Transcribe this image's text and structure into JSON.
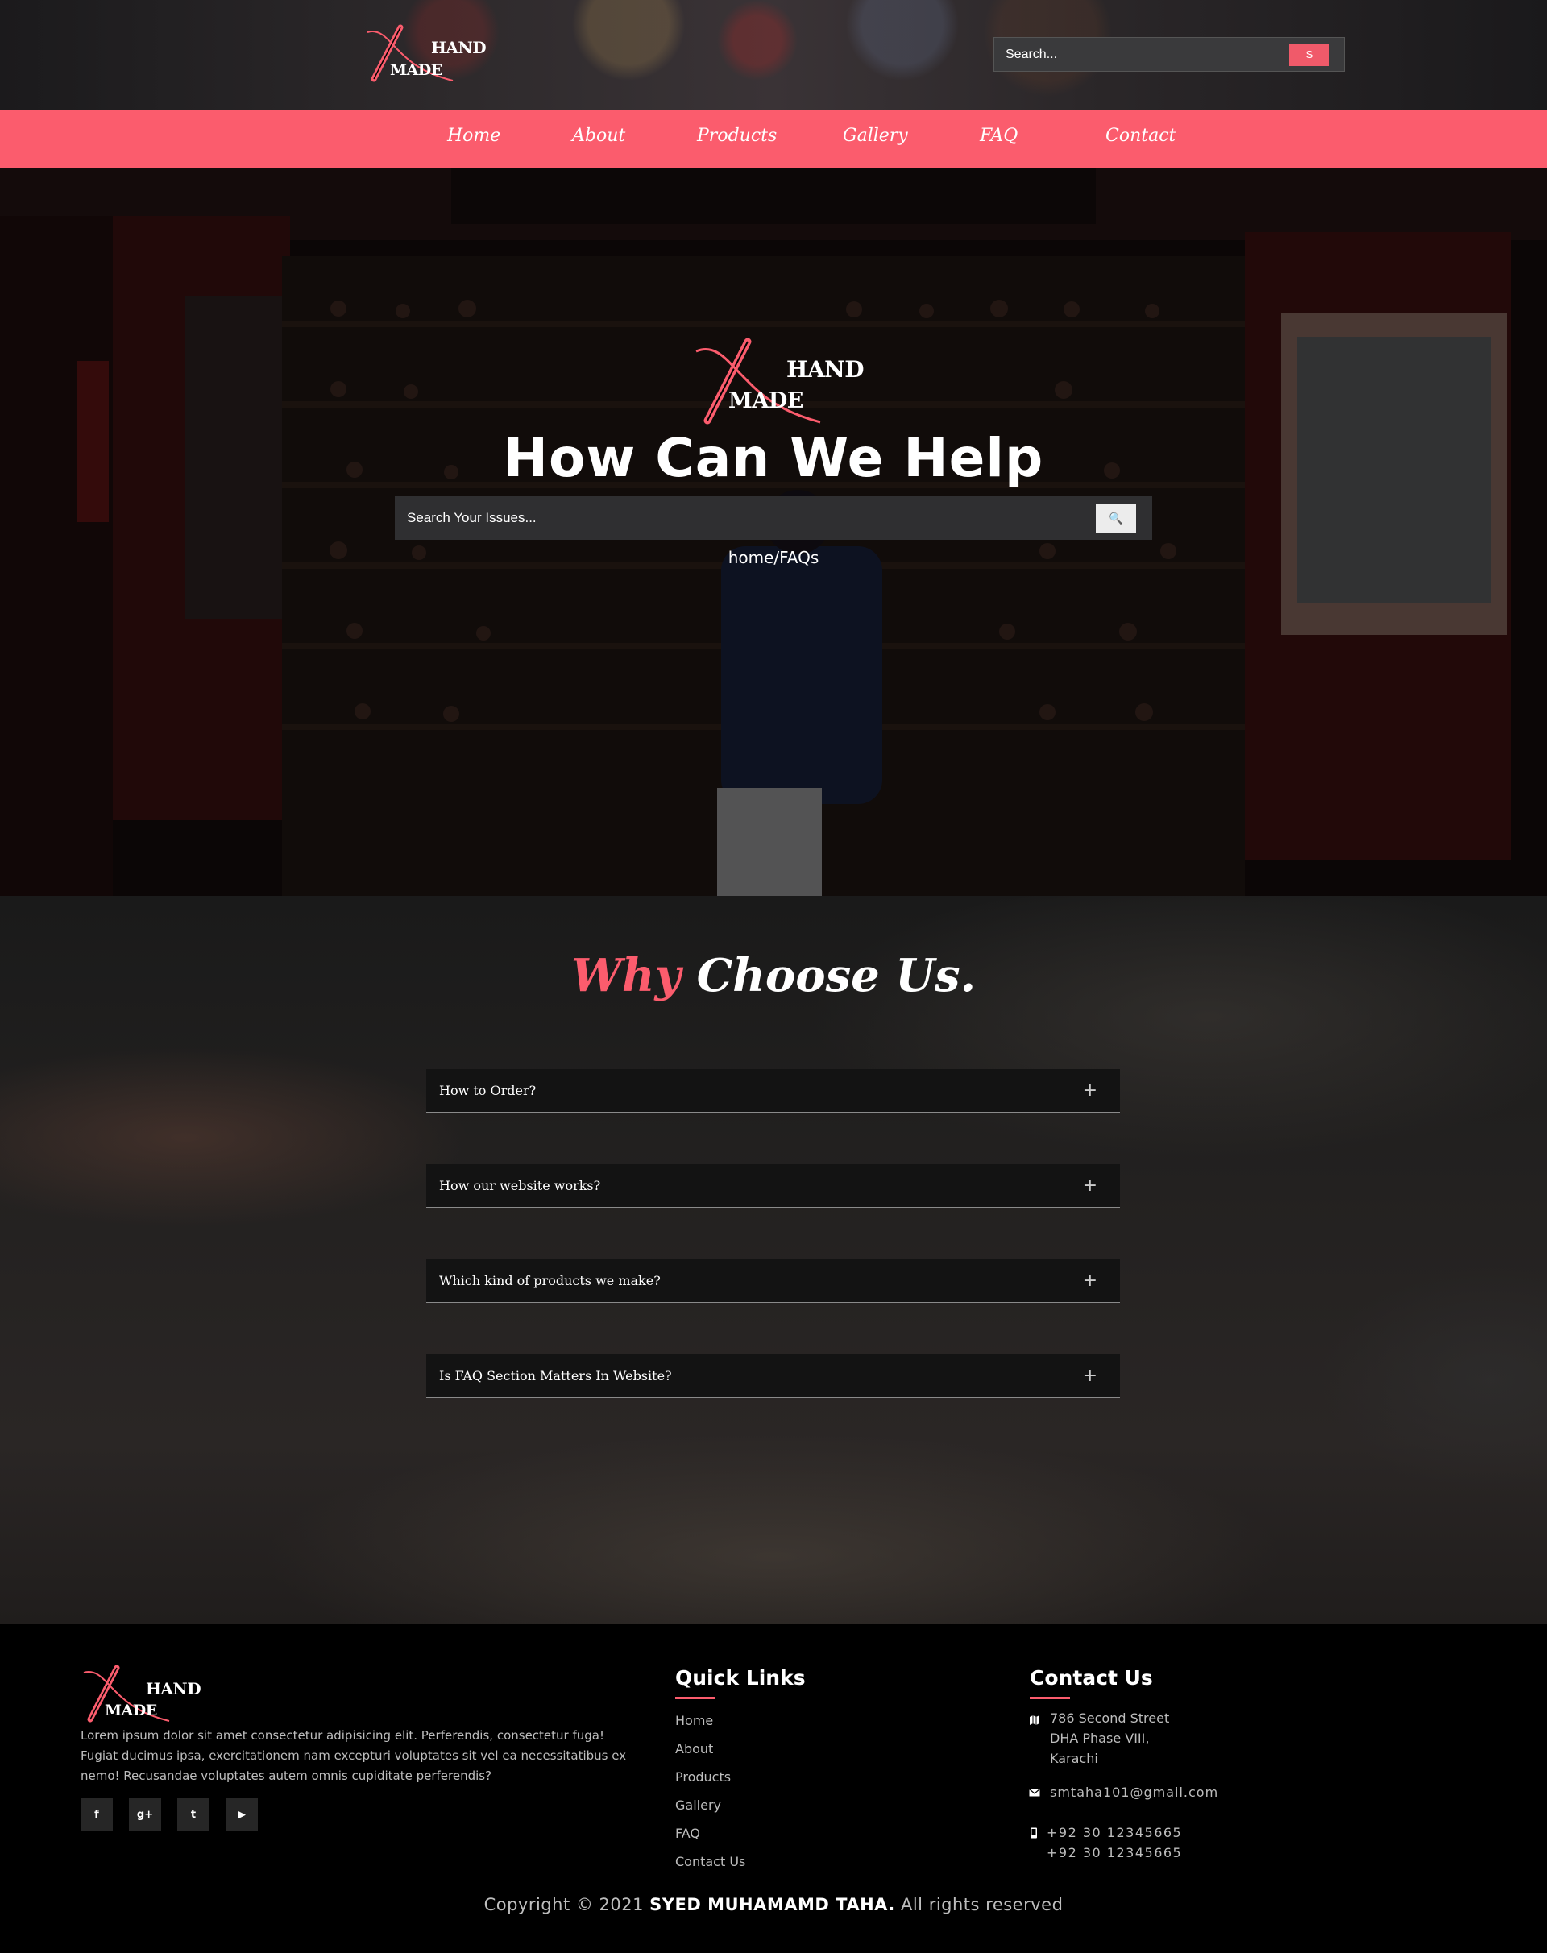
{
  "brand": {
    "logo_top": "HAND",
    "logo_bottom": "MADE",
    "accent_color": "#fb5c6d"
  },
  "header": {
    "search_placeholder": "Search...",
    "search_button": "S"
  },
  "nav": {
    "items": [
      {
        "label": "Home"
      },
      {
        "label": "About"
      },
      {
        "label": "Products"
      },
      {
        "label": "Gallery"
      },
      {
        "label": "FAQ"
      },
      {
        "label": "Contact"
      }
    ]
  },
  "hero": {
    "title": "How Can We Help",
    "search_placeholder": "Search Your Issues...",
    "search_icon": "search-icon",
    "breadcrumb": "home/FAQs"
  },
  "faq": {
    "heading_accent": "Why",
    "heading_rest": "Choose Us.",
    "expand_icon": "+",
    "items": [
      {
        "question": "How to Order?"
      },
      {
        "question": "How our website works?"
      },
      {
        "question": "Which kind of products we make?"
      },
      {
        "question": "Is FAQ Section Matters In Website?"
      }
    ]
  },
  "footer": {
    "about": "Lorem ipsum dolor sit amet consectetur adipisicing elit. Perferendis, consectetur fuga! Fugiat ducimus ipsa, exercitationem nam excepturi voluptates sit vel ea necessitatibus ex nemo! Recusandae voluptates autem omnis cupiditate perferendis?",
    "social": [
      {
        "icon": "facebook-icon",
        "glyph": "f"
      },
      {
        "icon": "google-plus-icon",
        "glyph": "g+"
      },
      {
        "icon": "twitter-icon",
        "glyph": "t"
      },
      {
        "icon": "youtube-icon",
        "glyph": "▶"
      }
    ],
    "quick_links_title": "Quick Links",
    "quick_links": [
      "Home",
      "About",
      "Products",
      "Gallery",
      "FAQ",
      "Contact Us"
    ],
    "contact_title": "Contact Us",
    "address_lines": [
      "786 Second Street",
      "DHA Phase VIII,",
      "Karachi"
    ],
    "email": "smtaha101@gmail.com",
    "phones": [
      "+92 30 12345665",
      "+92 30 12345665"
    ],
    "copyright_prefix": "Copyright © 2021",
    "copyright_name": "SYED MUHAMAMD TAHA.",
    "copyright_suffix": "All rights reserved"
  }
}
